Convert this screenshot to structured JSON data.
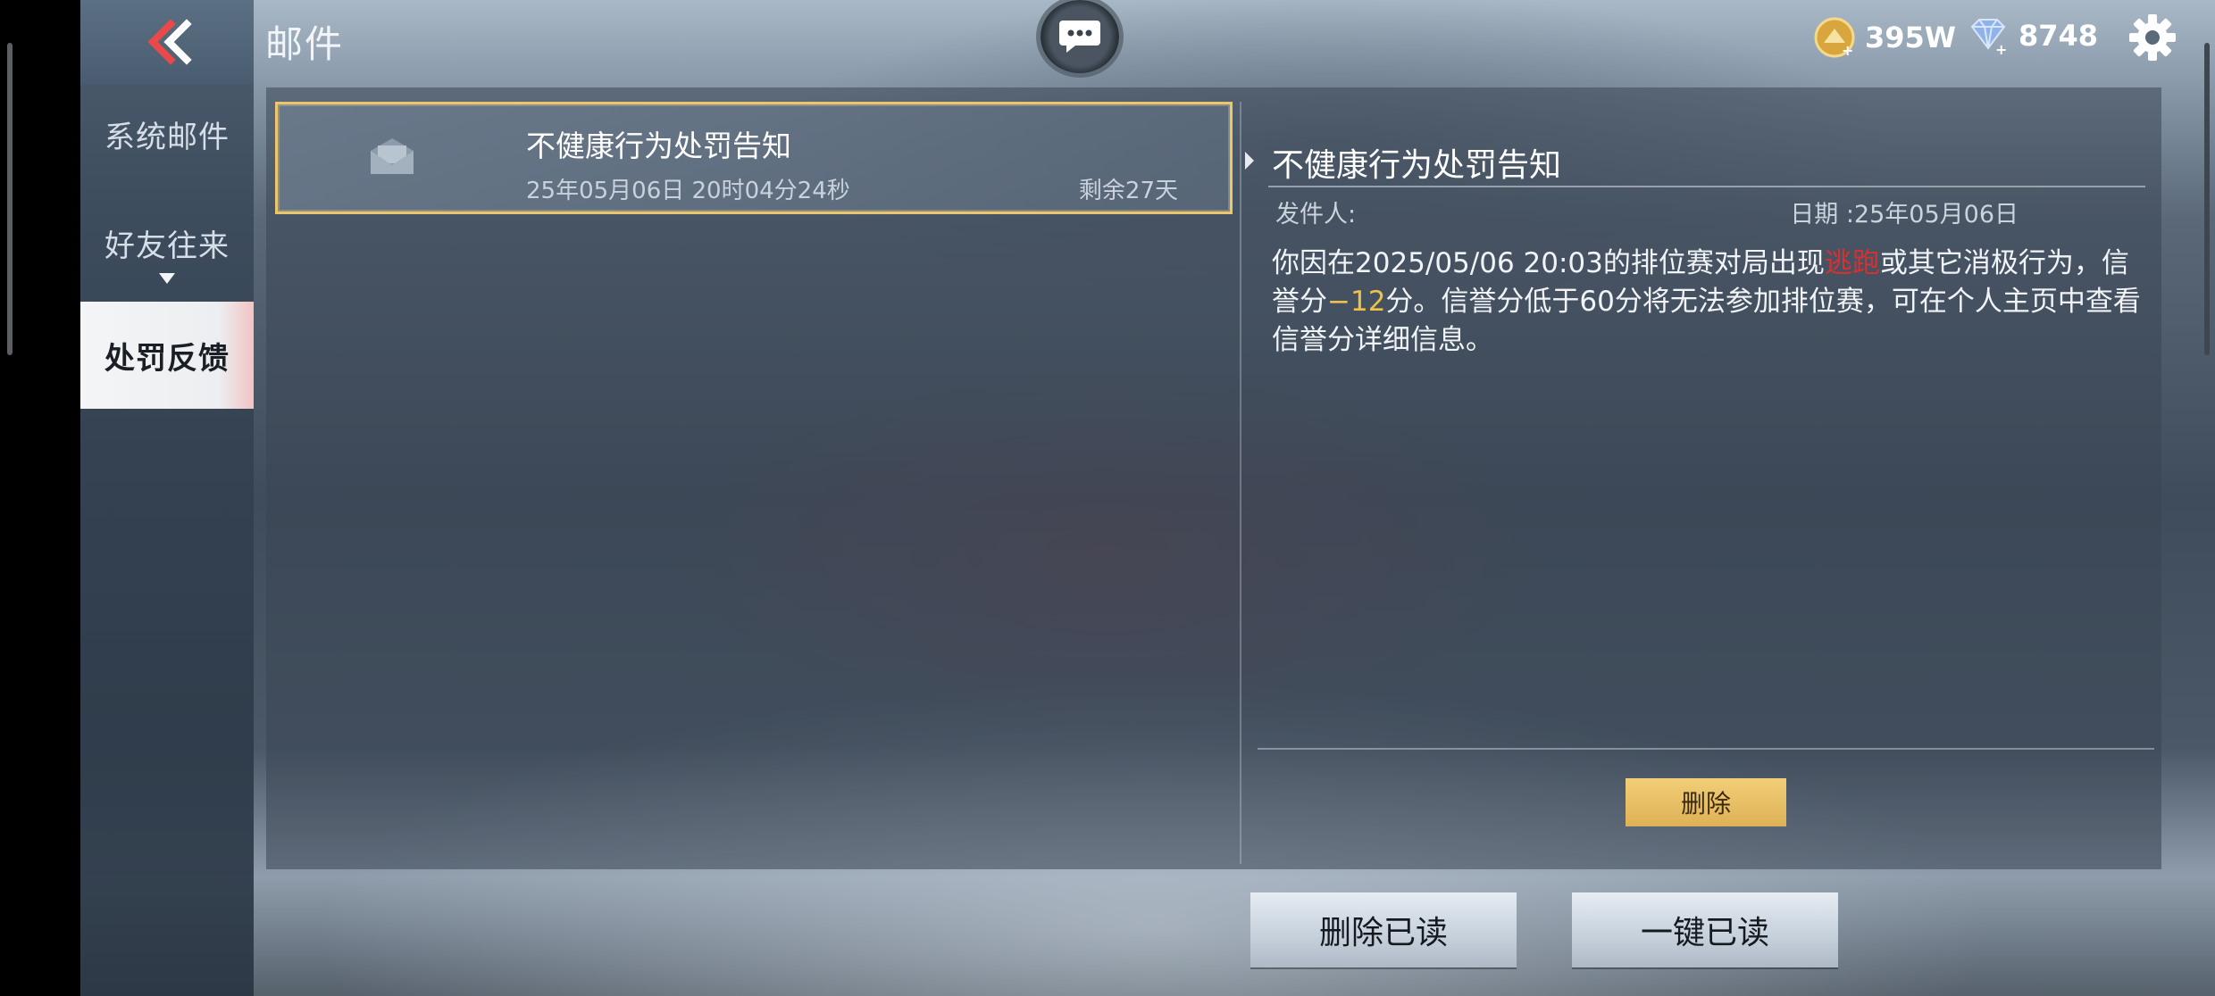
{
  "header": {
    "title": "邮件",
    "back_icon": "double-chevron-left-icon",
    "chat_icon": "chat-bubble-icon",
    "gold_amount": "395W",
    "diamond_amount": "8748",
    "settings_icon": "gear-icon"
  },
  "sidebar": {
    "items": [
      {
        "label": "系统邮件",
        "active": false
      },
      {
        "label": "好友往来",
        "active": false
      },
      {
        "label": "处罚反馈",
        "active": true
      }
    ]
  },
  "mail_list": [
    {
      "subject": "不健康行为处罚告知",
      "time": "25年05月06日 20时04分24秒",
      "remaining": "剩余27天",
      "icon": "envelope-icon"
    }
  ],
  "detail": {
    "title": "不健康行为处罚告知",
    "sender_label": "发件人:",
    "date_label": "日期 :25年05月06日",
    "body_part1": "你因在2025/05/06 20:03的排位赛对局出现",
    "body_highlight": "逃跑",
    "body_part2": "或其它消极行为，信誉分",
    "body_penalty": "−12",
    "body_part3": "分。信誉分低于60分将无法参加排位赛，可在个人主页中查看信誉分详细信息。",
    "delete_label": "删除"
  },
  "footer": {
    "delete_read_label": "删除已读",
    "mark_all_read_label": "一键已读"
  },
  "colors": {
    "accent_gold": "#ecc76a",
    "penalty_red": "#d63131",
    "penalty_gold": "#f0c14a"
  }
}
